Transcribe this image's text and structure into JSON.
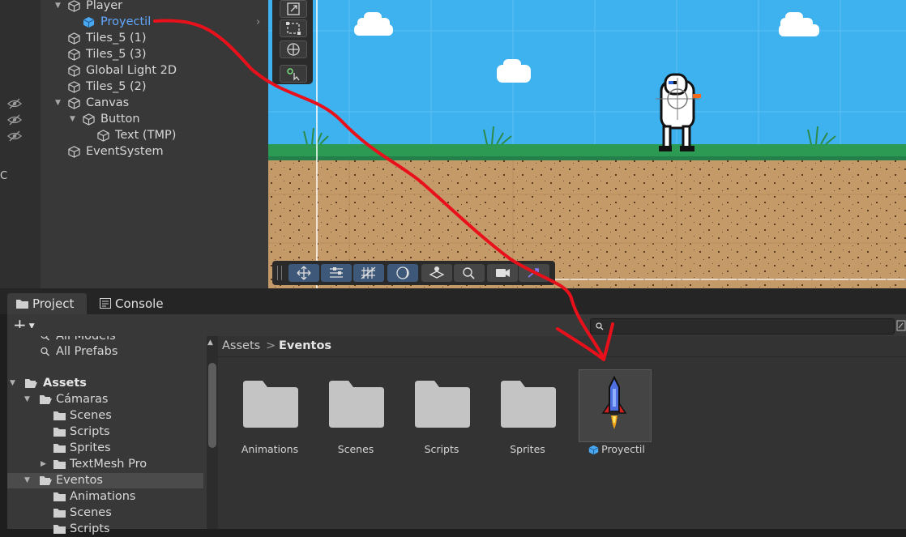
{
  "hierarchy": {
    "items": [
      {
        "label": "Player",
        "selected": false
      },
      {
        "label": "Proyectil",
        "selected": true
      },
      {
        "label": "Tiles_5 (1)",
        "selected": false
      },
      {
        "label": "Tiles_5 (3)",
        "selected": false
      },
      {
        "label": "Global Light 2D",
        "selected": false
      },
      {
        "label": "Tiles_5 (2)",
        "selected": false
      },
      {
        "label": "Canvas",
        "selected": false
      },
      {
        "label": "Button",
        "selected": false
      },
      {
        "label": "Text (TMP)",
        "selected": false
      },
      {
        "label": "EventSystem",
        "selected": false
      }
    ]
  },
  "tabs": {
    "project": "Project",
    "console": "Console"
  },
  "toolbar": {
    "add_label": "+"
  },
  "tree": {
    "items": [
      {
        "label": "All Models"
      },
      {
        "label": "All Prefabs"
      },
      {
        "label": "Assets"
      },
      {
        "label": "Cámaras"
      },
      {
        "label": "Scenes"
      },
      {
        "label": "Scripts"
      },
      {
        "label": "Sprites"
      },
      {
        "label": "TextMesh Pro"
      },
      {
        "label": "Eventos"
      },
      {
        "label": "Animations"
      },
      {
        "label": "Scenes"
      },
      {
        "label": "Scripts"
      }
    ]
  },
  "breadcrumb": {
    "root": "Assets",
    "separator": ">",
    "current": "Eventos"
  },
  "assets": [
    {
      "label": "Animations",
      "type": "folder"
    },
    {
      "label": "Scenes",
      "type": "folder"
    },
    {
      "label": "Scripts",
      "type": "folder"
    },
    {
      "label": "Sprites",
      "type": "folder"
    },
    {
      "label": "Proyectil",
      "type": "prefab"
    }
  ],
  "colors": {
    "selection_text": "#62a8ff",
    "annotation_red": "#e8111b",
    "sky": "#3eb2ee",
    "folder": "#c4c4c4"
  }
}
